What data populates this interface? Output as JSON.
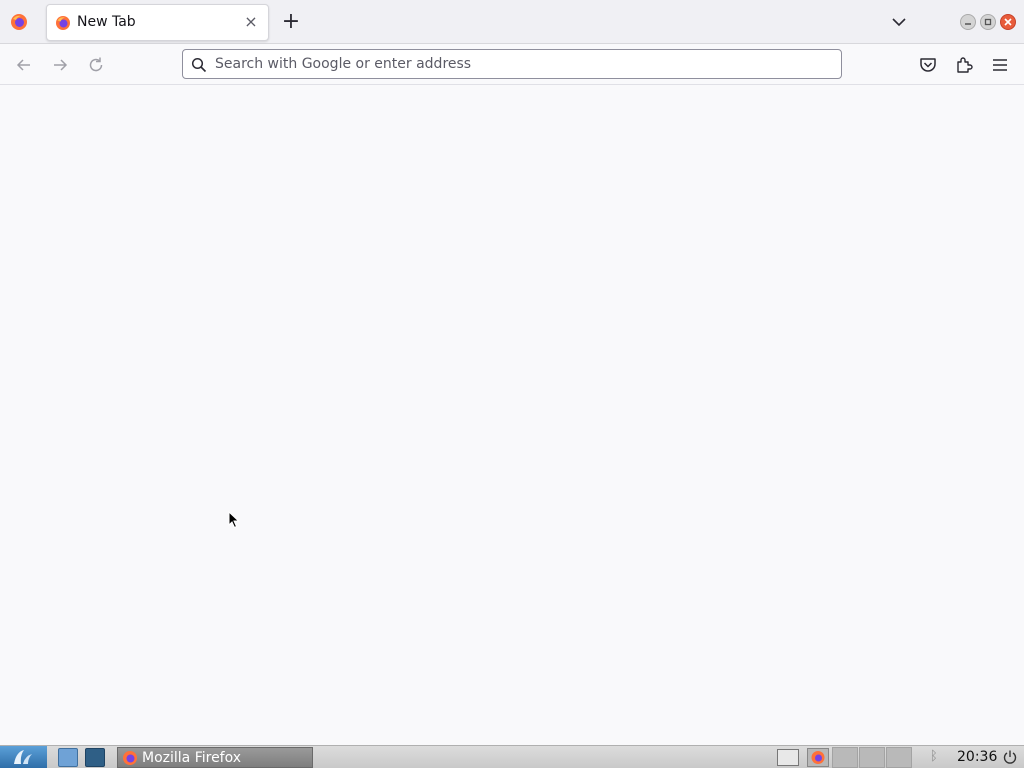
{
  "browser": {
    "tab": {
      "title": "New Tab",
      "close_symbol": "×"
    },
    "new_tab_symbol": "+",
    "urlbar": {
      "placeholder": "Search with Google or enter address",
      "value": ""
    }
  },
  "icons": {
    "firefox_menu": "firefox-logo-icon",
    "tab_favicon": "firefox-logo-icon",
    "list_all_tabs": "chevron-down-icon",
    "back": "arrow-left-icon",
    "forward": "arrow-right-icon",
    "reload": "reload-icon",
    "search": "search-icon",
    "pocket": "pocket-icon",
    "extensions": "puzzle-icon",
    "menu": "hamburger-menu-icon"
  },
  "taskbar": {
    "task_label": "Mozilla Firefox",
    "clock": "20:36",
    "bluetooth_symbol": "ᛒ"
  },
  "colors": {
    "accent": "#2f6ea8",
    "close_button": "#e85c3b",
    "firefox_orange": "#ff7139",
    "firefox_purple": "#7542e5"
  }
}
